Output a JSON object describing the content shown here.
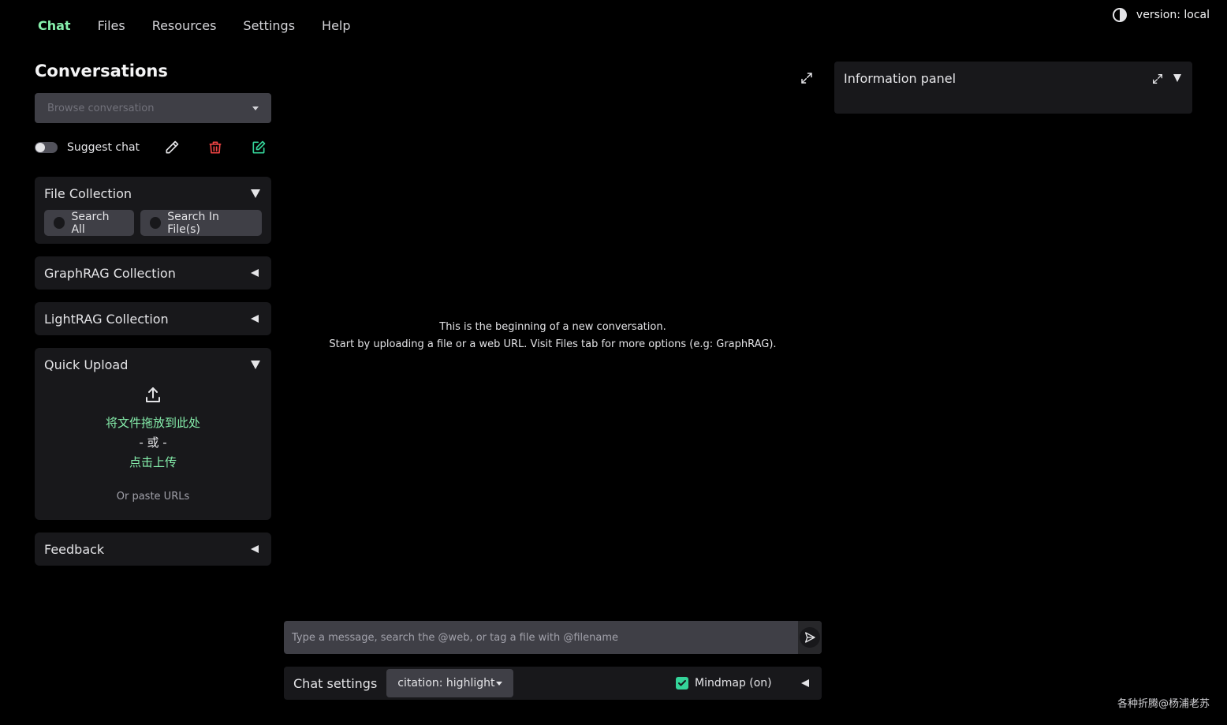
{
  "nav": {
    "tabs": [
      {
        "label": "Chat",
        "active": true
      },
      {
        "label": "Files"
      },
      {
        "label": "Resources"
      },
      {
        "label": "Settings"
      },
      {
        "label": "Help"
      }
    ],
    "version": "version: local"
  },
  "sidebar": {
    "title": "Conversations",
    "browse_placeholder": "Browse conversation",
    "suggest_chat_label": "Suggest chat",
    "suggest_chat_on": false,
    "file_collection": {
      "title": "File Collection",
      "options": [
        "Search All",
        "Search In File(s)"
      ]
    },
    "graphrag_title": "GraphRAG Collection",
    "lightrag_title": "LightRAG Collection",
    "quick_upload": {
      "title": "Quick Upload",
      "drop_text": "将文件拖放到此处",
      "or_text": "- 或 -",
      "click_text": "点击上传",
      "paste_text": "Or paste URLs"
    },
    "feedback_title": "Feedback"
  },
  "chat": {
    "welcome_line1": "This is the beginning of a new conversation.",
    "welcome_line2": "Start by uploading a file or a web URL. Visit Files tab for more options (e.g: GraphRAG).",
    "input_placeholder": "Type a message, search the @web, or tag a file with @filename",
    "settings_label": "Chat settings",
    "citation_value": "citation: highlight",
    "mindmap_label": "Mindmap (on)",
    "mindmap_checked": true
  },
  "info_panel": {
    "title": "Information panel"
  },
  "watermark": "各种折腾@杨浦老苏",
  "colors": {
    "accent": "#86efac",
    "delete": "#ef4444",
    "new": "#34d399",
    "panel": "#18181b",
    "input": "#3f3f46"
  }
}
